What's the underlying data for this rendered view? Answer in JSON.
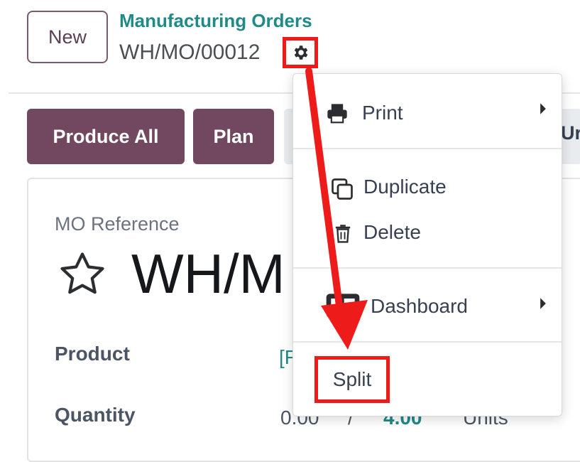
{
  "header": {
    "new_label": "New",
    "breadcrumb_parent": "Manufacturing Orders",
    "record_name": "WH/MO/00012"
  },
  "actions": {
    "produce_all": "Produce All",
    "plan": "Plan",
    "partial_label": "Ur"
  },
  "form": {
    "mo_reference_label": "MO Reference",
    "mo_reference_value_visible": "WH/M",
    "product_label": "Product",
    "product_value_visible": "[F",
    "quantity_label": "Quantity",
    "quantity_produced": "0.00",
    "quantity_separator": "/",
    "quantity_total": "4.00",
    "quantity_uom": "Units"
  },
  "menu": {
    "print": "Print",
    "duplicate": "Duplicate",
    "delete": "Delete",
    "dashboard": "Dashboard",
    "split": "Split"
  },
  "colors": {
    "primary": "#71485f",
    "link": "#1f8a87",
    "highlight": "#ee1b1b"
  },
  "icons": [
    "gear-icon",
    "printer-icon",
    "duplicate-icon",
    "trash-icon",
    "dashboard-icon",
    "star-icon",
    "caret-right-icon"
  ]
}
